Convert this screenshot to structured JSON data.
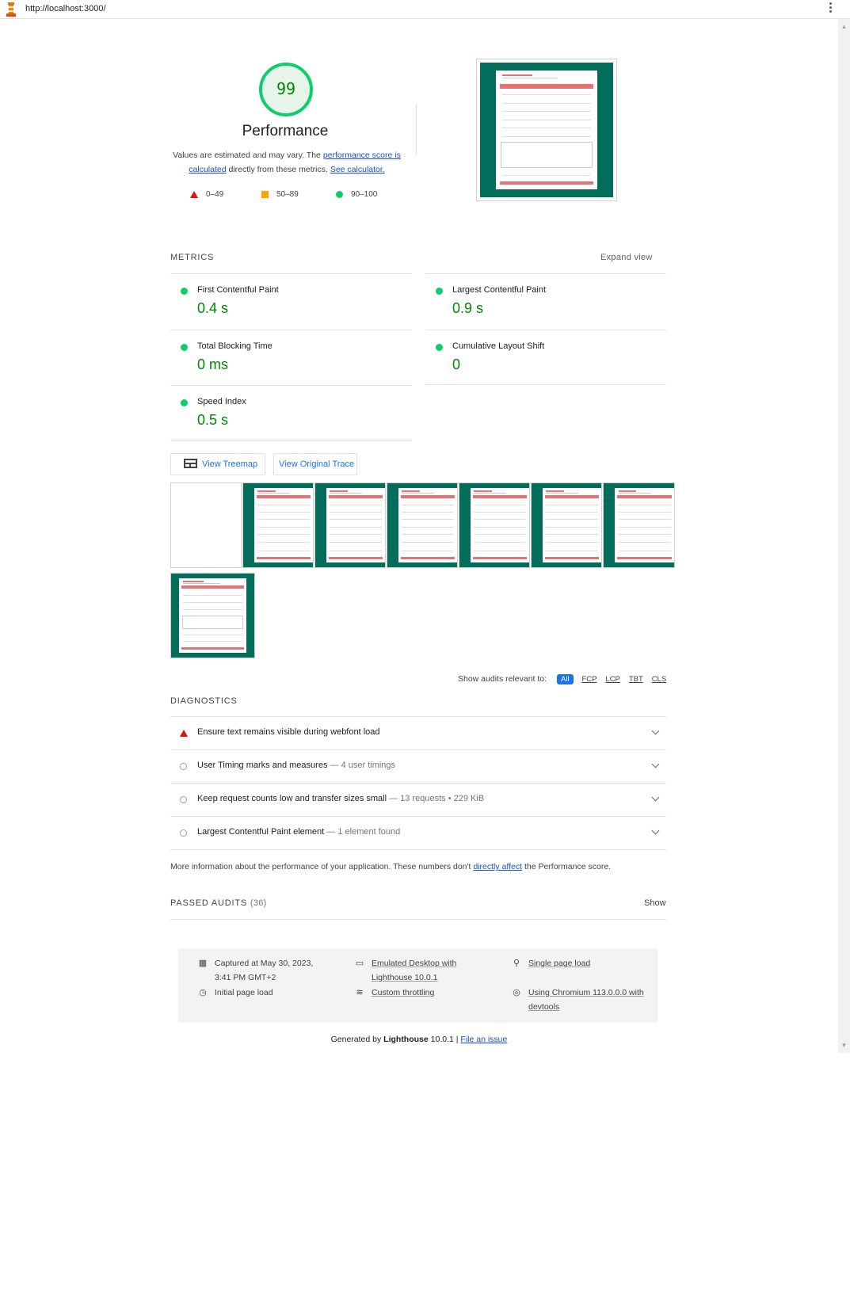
{
  "browser": {
    "url": "http://localhost:3000/"
  },
  "score": {
    "value": "99",
    "title": "Performance",
    "desc_prefix": "Values are estimated and may vary. The ",
    "desc_link1": "performance score is calculated",
    "desc_mid": " directly from these metrics. ",
    "desc_link2": "See calculator.",
    "legend": [
      {
        "range": "0–49",
        "color": "#eb0f00",
        "shape": "triangle"
      },
      {
        "range": "50–89",
        "color": "#ffa400",
        "shape": "square"
      },
      {
        "range": "90–100",
        "color": "#0cce6b",
        "shape": "circle"
      }
    ]
  },
  "metrics": {
    "header": "METRICS",
    "expand_label": "Expand view",
    "items": [
      {
        "label": "First Contentful Paint",
        "value": "0.4 s"
      },
      {
        "label": "Largest Contentful Paint",
        "value": "0.9 s"
      },
      {
        "label": "Total Blocking Time",
        "value": "0 ms"
      },
      {
        "label": "Cumulative Layout Shift",
        "value": "0"
      },
      {
        "label": "Speed Index",
        "value": "0.5 s"
      }
    ],
    "buttons": {
      "treemap": "View Treemap",
      "trace": "View Original Trace"
    }
  },
  "filter": {
    "label": "Show audits relevant to:",
    "options": [
      "All",
      "FCP",
      "LCP",
      "TBT",
      "CLS"
    ],
    "active": "All"
  },
  "diagnostics": {
    "header": "DIAGNOSTICS",
    "items": [
      {
        "title": "Ensure text remains visible during webfont load",
        "display": "",
        "status": "fail"
      },
      {
        "title": "User Timing marks and measures",
        "display": "— 4 user timings",
        "status": "info"
      },
      {
        "title": "Keep request counts low and transfer sizes small",
        "display": "— 13 requests • 229 KiB",
        "status": "info"
      },
      {
        "title": "Largest Contentful Paint element",
        "display": "— 1 element found",
        "status": "info"
      }
    ],
    "more_prefix": "More information about the performance of your application. These numbers don't ",
    "more_link": "directly affect",
    "more_suffix": " the Performance score."
  },
  "passed": {
    "label": "PASSED AUDITS",
    "count": "(36)",
    "show": "Show"
  },
  "environment": {
    "captured_1": "Captured at May 30, 2023,",
    "captured_2": "3:41 PM GMT+2",
    "initial": "Initial page load",
    "emulated_1": "Emulated Desktop with",
    "emulated_2": "Lighthouse 10.0.1",
    "throttling": "Custom throttling",
    "single": "Single page load",
    "chromium_1": "Using Chromium 113.0.0.0 with",
    "chromium_2": "devtools"
  },
  "footer": {
    "prefix": "Generated by ",
    "brand": "Lighthouse",
    "version": " 10.0.1 | ",
    "link": "File an issue"
  },
  "colors": {
    "pass": "#0cce6b",
    "fail": "#eb0f00",
    "average": "#ffa400",
    "link": "#1a4fba",
    "screenshot_bg": "#016d5a"
  }
}
